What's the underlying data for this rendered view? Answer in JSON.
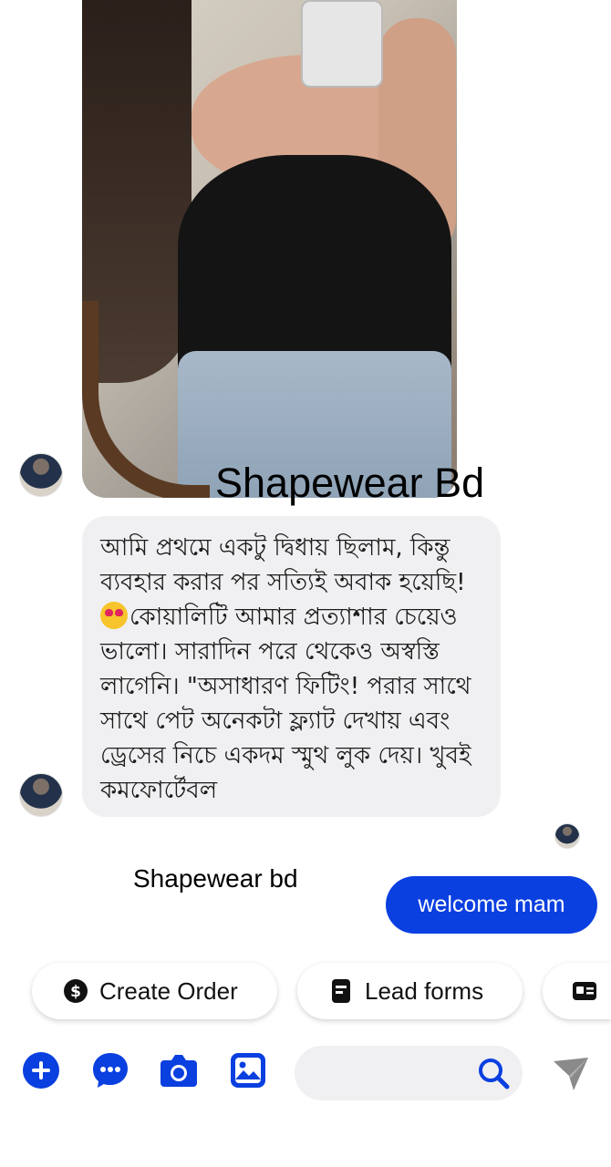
{
  "thread": {
    "watermark": "Shapewear Bd",
    "incoming_message_lines": [
      "আমি প্রথমে একটু দ্বিধায় ছিলাম, কিন্তু",
      "ব্যবহার করার পর সত্যিই অবাক হয়েছি!",
      "কোয়ালিটি আমার প্রত্যাশার চেয়েও",
      "ভালো। সারাদিন পরে থেকেও অস্বস্তি",
      "লাগেনি। \"অসাধারণ ফিটিং! পরার সাথে",
      "সাথে পেট অনেকটা ফ্ল্যাট দেখায় এবং",
      "ড্রেসের নিচে একদম স্মুথ লুক দেয়। খুবই",
      "কমফোর্টেবল"
    ],
    "incoming_emoji": "heart-eyes-emoji",
    "sender_label": "Shapewear bd",
    "outgoing_message": "welcome mam"
  },
  "quick_actions": [
    {
      "label": "Create Order",
      "icon": "dollar-icon"
    },
    {
      "label": "Lead forms",
      "icon": "form-icon"
    },
    {
      "label": "",
      "icon": "id-card-icon"
    }
  ],
  "composer": {
    "search_placeholder": "",
    "icons": [
      "plus-icon",
      "chat-bubble-icon",
      "camera-icon",
      "image-icon",
      "search-icon",
      "send-icon"
    ]
  },
  "colors": {
    "accent": "#0a3fe0",
    "bubble_in": "#f0f0f2",
    "send_disabled": "#8a8a8a"
  }
}
